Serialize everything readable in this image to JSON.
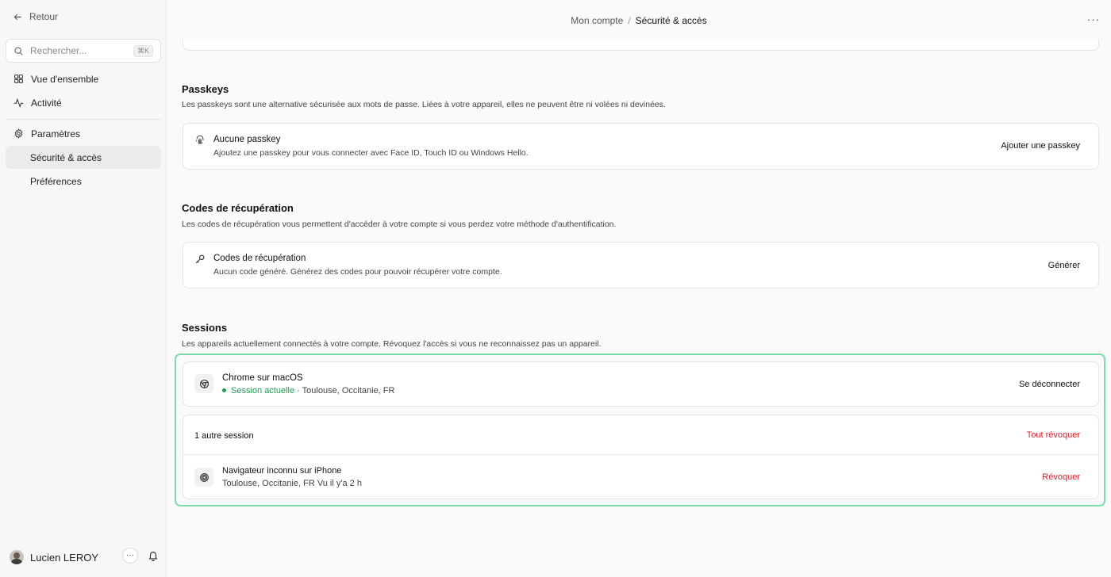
{
  "sidebar": {
    "back_label": "Retour",
    "search": {
      "placeholder": "Rechercher...",
      "shortcut": "⌘K"
    },
    "items": [
      {
        "label": "Vue d'ensemble",
        "icon": "grid-icon"
      },
      {
        "label": "Activité",
        "icon": "activity-icon"
      },
      {
        "label": "Paramètres",
        "icon": "gear-icon"
      },
      {
        "label": "Sécurité & accès",
        "active": true
      },
      {
        "label": "Préférences"
      }
    ],
    "user": {
      "name": "Lucien LEROY"
    }
  },
  "header": {
    "breadcrumb": [
      "Mon compte",
      "Sécurité & accès"
    ],
    "separator": "/",
    "more": "···"
  },
  "passkeys": {
    "title": "Passkeys",
    "description": "Les passkeys sont une alternative sécurisée aux mots de passe. Liées à votre appareil, elles ne peuvent être ni volées ni devinées.",
    "row": {
      "title": "Aucune passkey",
      "subtitle": "Ajoutez une passkey pour vous connecter avec Face ID, Touch ID ou Windows Hello.",
      "action": "Ajouter une passkey"
    }
  },
  "recovery": {
    "title": "Codes de récupération",
    "description": "Les codes de récupération vous permettent d'accéder à votre compte si vous perdez votre méthode d'authentification.",
    "row": {
      "title": "Codes de récupération",
      "subtitle": "Aucun code généré. Générez des codes pour pouvoir récupérer votre compte.",
      "action": "Générer"
    }
  },
  "sessions": {
    "title": "Sessions",
    "description": "Les appareils actuellement connectés à votre compte. Révoquez l'accès si vous ne reconnaissez pas un appareil.",
    "current": {
      "title": "Chrome sur macOS",
      "status": "Session actuelle",
      "location": " · Toulouse, Occitanie, FR",
      "action": "Se déconnecter"
    },
    "others": {
      "count_label": "1 autre session",
      "revoke_all": "Tout révoquer",
      "items": [
        {
          "title": "Navigateur inconnu sur iPhone",
          "subtitle": "Toulouse, Occitanie, FR Vu il y'a 2 h",
          "action": "Révoquer"
        }
      ]
    }
  },
  "colors": {
    "accent_green": "#1e9b4f",
    "danger_red": "#d9232f",
    "highlight": "#7ddcad"
  }
}
